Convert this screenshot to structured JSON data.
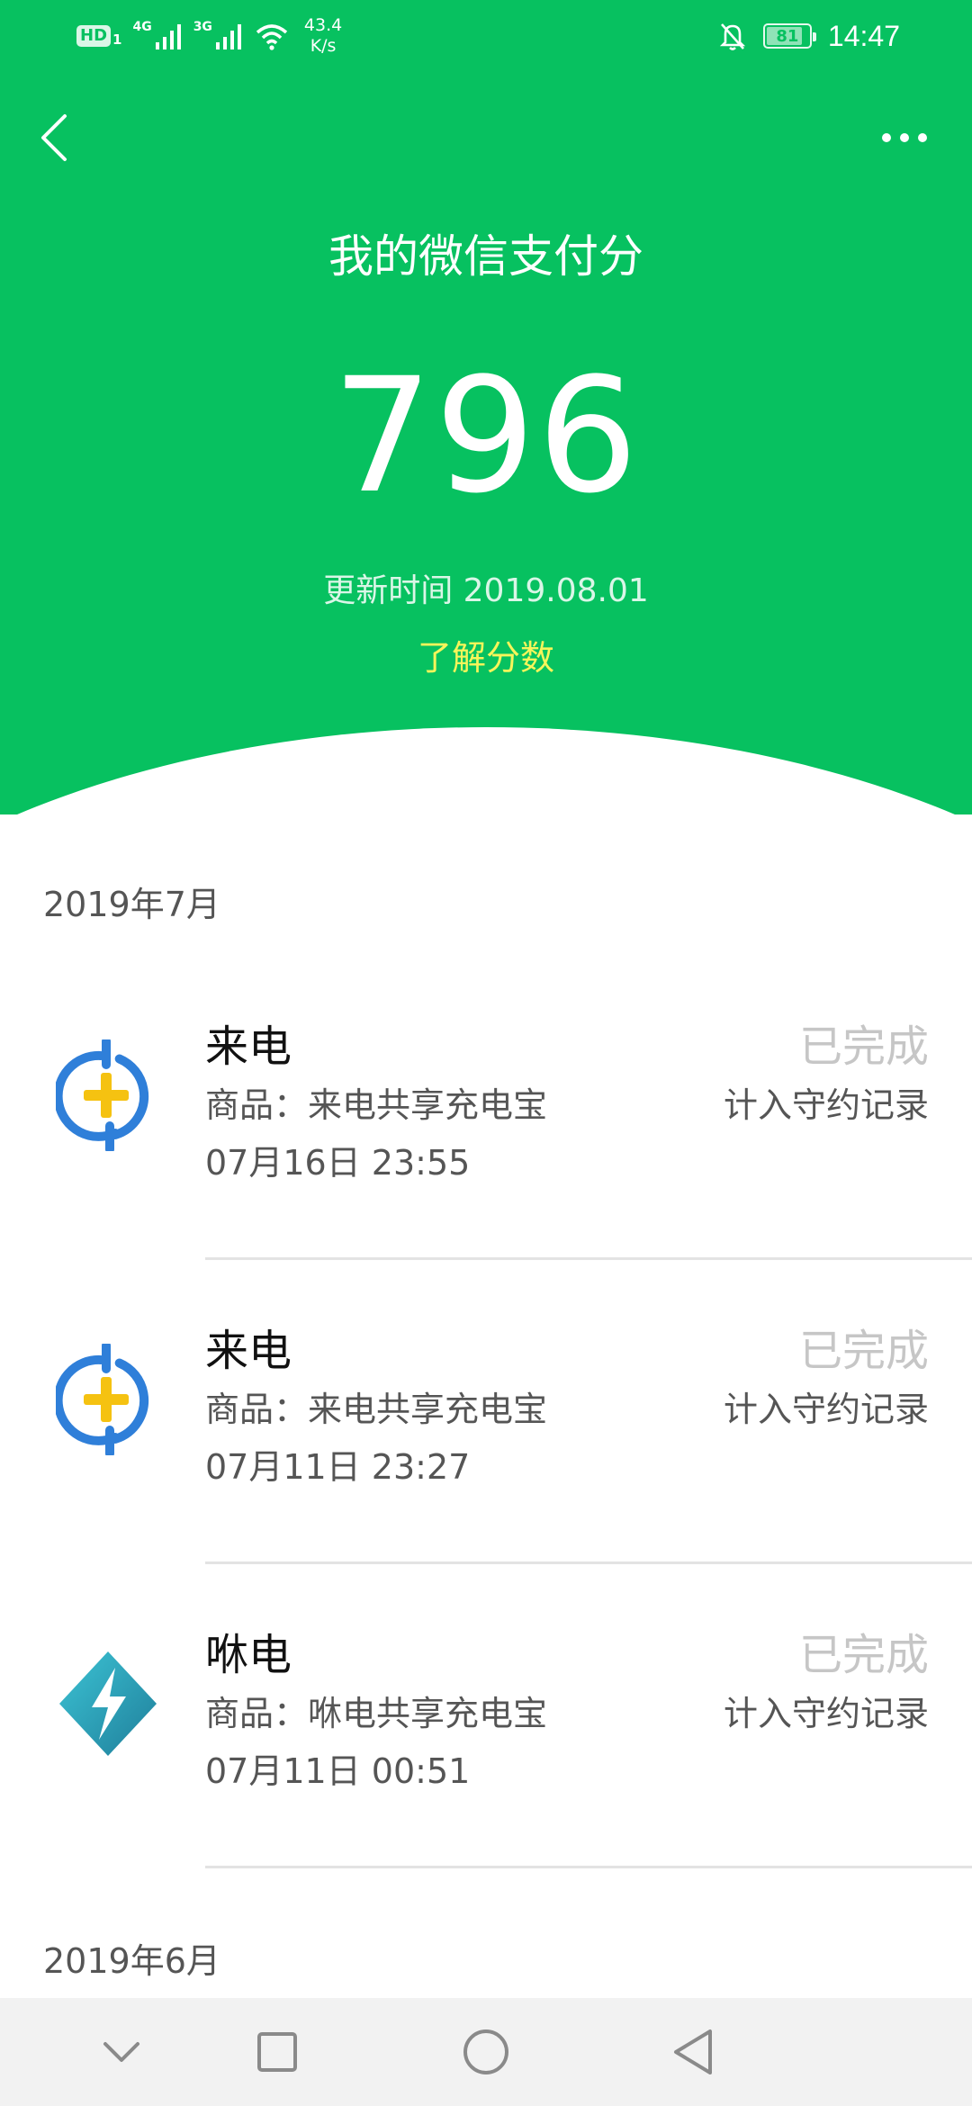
{
  "status_bar": {
    "hd": "HD",
    "sim1_label": "1",
    "net1": "4G",
    "net2": "3G",
    "speed_value": "43.4",
    "speed_unit": "K/s",
    "battery": "81",
    "time": "14:47"
  },
  "header": {
    "title": "我的微信支付分",
    "score": "796",
    "update_time": "更新时间 2019.08.01",
    "learn_link": "了解分数",
    "accent_color": "#07c160",
    "link_color": "#f7f55a"
  },
  "months": [
    {
      "label": "2019年7月"
    },
    {
      "label": "2019年6月"
    }
  ],
  "records": [
    {
      "name": "来电",
      "product": "商品：来电共享充电宝",
      "time": "07月16日 23:55",
      "status": "已完成",
      "note": "计入守约记录",
      "icon": "laidian-logo-icon"
    },
    {
      "name": "来电",
      "product": "商品：来电共享充电宝",
      "time": "07月11日 23:27",
      "status": "已完成",
      "note": "计入守约记录",
      "icon": "laidian-logo-icon"
    },
    {
      "name": "咻电",
      "product": "商品：咻电共享充电宝",
      "time": "07月11日 00:51",
      "status": "已完成",
      "note": "计入守约记录",
      "icon": "xiudian-logo-icon"
    }
  ],
  "nav_bar": {
    "icons": [
      "chevron-down-icon",
      "recent-apps-icon",
      "home-icon",
      "back-triangle-icon"
    ]
  }
}
